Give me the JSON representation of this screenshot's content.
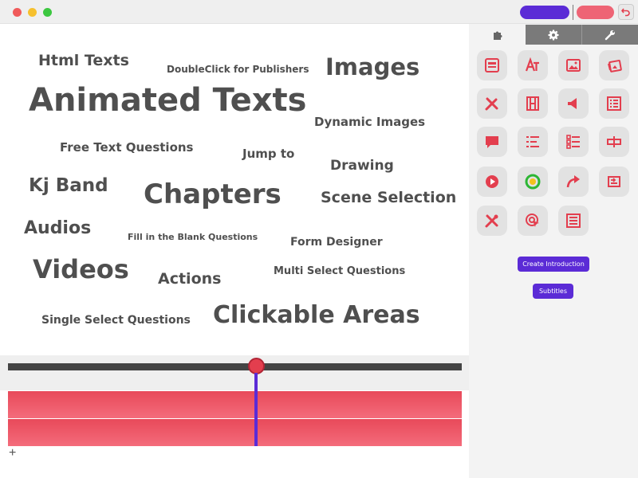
{
  "window": {
    "title": ""
  },
  "tag_cloud": [
    "Html Texts",
    "DoubleClick for Publishers",
    "Images",
    "Animated Texts",
    "Dynamic Images",
    "Free Text Questions",
    "Jump to",
    "Drawing",
    "Kj Band",
    "Chapters",
    "Scene Selection",
    "Audios",
    "Fill in the Blank Questions",
    "Form Designer",
    "Videos",
    "Actions",
    "Multi Select Questions",
    "Single Select Questions",
    "Clickable Areas"
  ],
  "panel": {
    "tabs": [
      {
        "icon": "puzzle-icon"
      },
      {
        "icon": "gear-icon"
      },
      {
        "icon": "wrench-icon"
      }
    ],
    "tools": [
      "form-icon",
      "text-icon",
      "image-icon",
      "dynamic-images-icon",
      "drawing-icon",
      "film-icon",
      "audio-icon",
      "chapters-list-icon",
      "speech-bubble-icon",
      "free-text-icon",
      "checklist-icon",
      "text-cursor-icon",
      "play-action-icon",
      "connect-icon",
      "jump-arrow-icon",
      "scene-selection-icon",
      "tools-icon",
      "target-click-icon",
      "form-designer-icon"
    ],
    "create_intro_label": "Create Introduction",
    "subtitles_label": "Subtitles"
  },
  "timeline": {
    "add_label": "+"
  },
  "colors": {
    "accent": "#5b2bd6",
    "tool_red": "#e33e4e",
    "text_gray": "#4f4f4f"
  }
}
